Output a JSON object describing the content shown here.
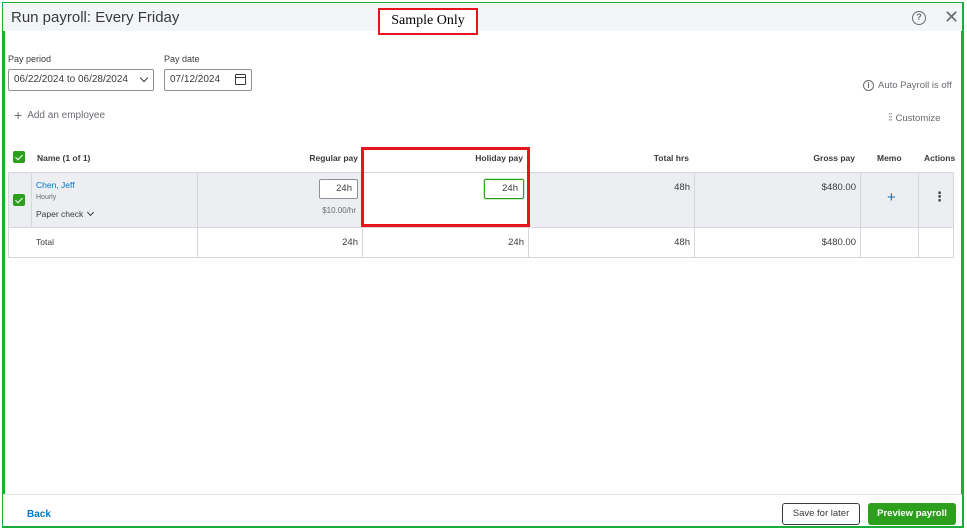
{
  "header": {
    "title": "Run payroll: Every Friday",
    "sample_label": "Sample Only"
  },
  "pay_period": {
    "label": "Pay period",
    "value": "06/22/2024 to 06/28/2024"
  },
  "pay_date": {
    "label": "Pay date",
    "value": "07/12/2024"
  },
  "auto_payroll": "Auto Payroll is off",
  "add_employee": "Add an employee",
  "customize": "Customize",
  "table": {
    "columns": {
      "name": "Name (1 of 1)",
      "regular_pay": "Regular pay",
      "holiday_pay": "Holiday pay",
      "total_hrs": "Total hrs",
      "gross_pay": "Gross pay",
      "memo": "Memo",
      "actions": "Actions"
    },
    "employee": {
      "name": "Chen, Jeff",
      "type": "Hourly",
      "payment_method": "Paper check",
      "regular_hours": "24h",
      "rate": "$10.00/hr",
      "holiday_hours": "24h",
      "total_hrs": "48h",
      "gross_pay": "$480.00"
    },
    "total": {
      "label": "Total",
      "regular_pay": "24h",
      "holiday_pay": "24h",
      "total_hrs": "48h",
      "gross_pay": "$480.00"
    }
  },
  "footer": {
    "back": "Back",
    "save_for_later": "Save for later",
    "preview_payroll": "Preview payroll"
  },
  "colors": {
    "accent_green": "#2ca01c",
    "link_blue": "#0077c5",
    "annotation_red": "#e8141c",
    "frame_green": "#1aad3a"
  }
}
